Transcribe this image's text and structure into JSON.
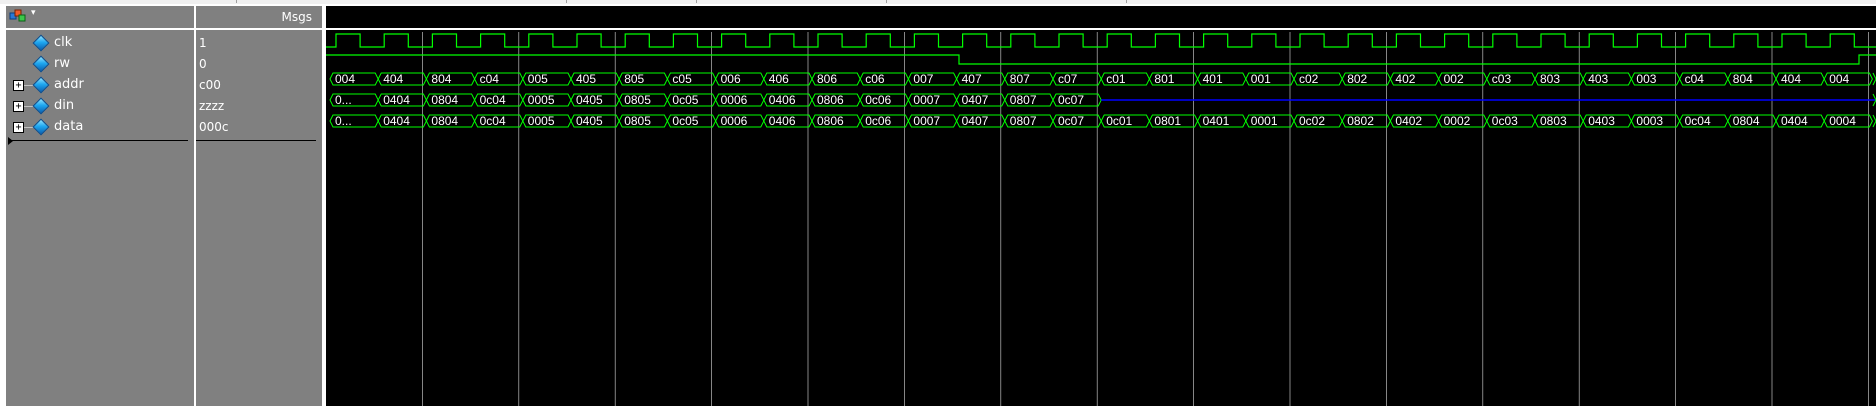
{
  "header": {
    "msgs_label": "Msgs"
  },
  "signals": [
    {
      "name": "clk",
      "value": "1",
      "expandable": false
    },
    {
      "name": "rw",
      "value": "0",
      "expandable": false
    },
    {
      "name": "addr",
      "value": "c00",
      "expandable": true
    },
    {
      "name": "din",
      "value": "zzzz",
      "expandable": true
    },
    {
      "name": "data",
      "value": "000c",
      "expandable": true
    }
  ],
  "waves": {
    "addr_segments": [
      "004",
      "404",
      "804",
      "c04",
      "005",
      "405",
      "805",
      "c05",
      "006",
      "406",
      "806",
      "c06",
      "007",
      "407",
      "807",
      "c07",
      "c01",
      "801",
      "401",
      "001",
      "c02",
      "802",
      "402",
      "002",
      "c03",
      "803",
      "403",
      "003",
      "c04",
      "804",
      "404",
      "004"
    ],
    "din_segments": [
      "0...",
      "0404",
      "0804",
      "0c04",
      "0005",
      "0405",
      "0805",
      "0c05",
      "0006",
      "0406",
      "0806",
      "0c06",
      "0007",
      "0407",
      "0807",
      "0c07"
    ],
    "data_segments": [
      "0...",
      "0404",
      "0804",
      "0c04",
      "0005",
      "0405",
      "0805",
      "0c05",
      "0006",
      "0406",
      "0806",
      "0c06",
      "0007",
      "0407",
      "0807",
      "0c07",
      "0c01",
      "0801",
      "0401",
      "0001",
      "0c02",
      "0802",
      "0402",
      "0002",
      "0c03",
      "0803",
      "0403",
      "0003",
      "0c04",
      "0804",
      "0404",
      "0004"
    ]
  },
  "colors": {
    "wave": "#00ff00",
    "grid": "#ffffff",
    "highz": "#0000ff",
    "panel": "#808080",
    "background": "#000000"
  },
  "icons": [
    "toolbar-waveform-icon",
    "dropdown-caret-icon",
    "signal-diamond-icon",
    "expand-plus-icon"
  ]
}
